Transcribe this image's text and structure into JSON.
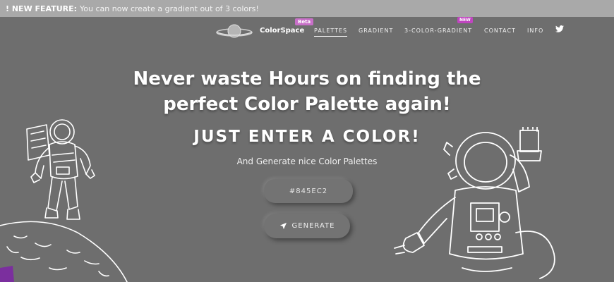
{
  "banner": {
    "label": "! NEW FEATURE:",
    "text": "You can now create a gradient out of 3 colors!"
  },
  "nav": {
    "brand": "ColorSpace",
    "brand_badge": "Beta",
    "links": [
      "PALETTES",
      "GRADIENT",
      "3-COLOR-GRADIENT",
      "CONTACT",
      "INFO"
    ],
    "new_badge": "NEW",
    "twitter_icon": "twitter-icon"
  },
  "hero": {
    "title_line1": "Never waste Hours on finding the",
    "title_line2": "perfect Color Palette again!",
    "subtitle": "JUST ENTER A COLOR!",
    "tagline": "And Generate nice Color Palettes",
    "input_value": "#845EC2",
    "generate_label": "GENERATE",
    "generate_icon": "rocket-icon"
  },
  "colors": {
    "background": "#6e6e6e",
    "banner": "#a9a9a9",
    "badge": "#c86fc8",
    "planet_accent": "#7b2f9e"
  }
}
